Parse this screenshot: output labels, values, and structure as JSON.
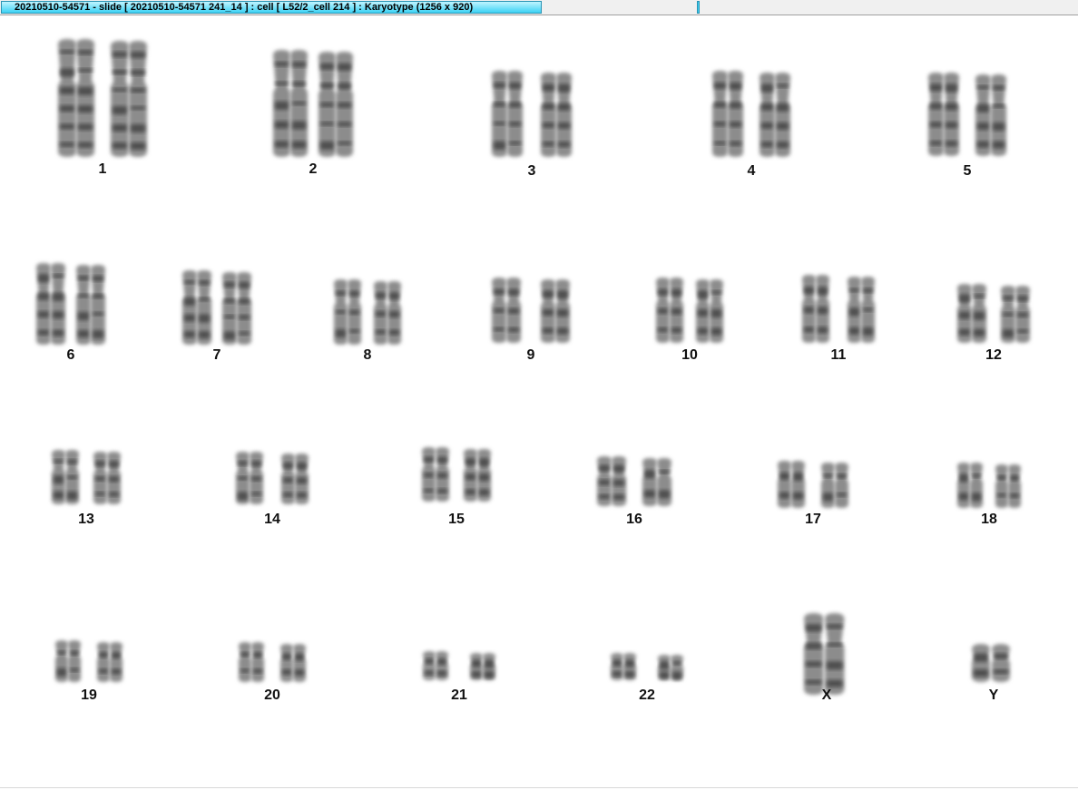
{
  "window": {
    "title": "20210510-54571 - slide [ 20210510-54571 241_14 ] : cell [ L52/2_cell 214 ] : Karyotype  (1256 x 920)"
  },
  "karyotype": {
    "chromosomes": [
      {
        "label": "1"
      },
      {
        "label": "2"
      },
      {
        "label": "3"
      },
      {
        "label": "4"
      },
      {
        "label": "5"
      },
      {
        "label": "6"
      },
      {
        "label": "7"
      },
      {
        "label": "8"
      },
      {
        "label": "9"
      },
      {
        "label": "10"
      },
      {
        "label": "11"
      },
      {
        "label": "12"
      },
      {
        "label": "13"
      },
      {
        "label": "14"
      },
      {
        "label": "15"
      },
      {
        "label": "16"
      },
      {
        "label": "17"
      },
      {
        "label": "18"
      },
      {
        "label": "19"
      },
      {
        "label": "20"
      },
      {
        "label": "21"
      },
      {
        "label": "22"
      },
      {
        "label": "X"
      },
      {
        "label": "Y"
      }
    ]
  }
}
